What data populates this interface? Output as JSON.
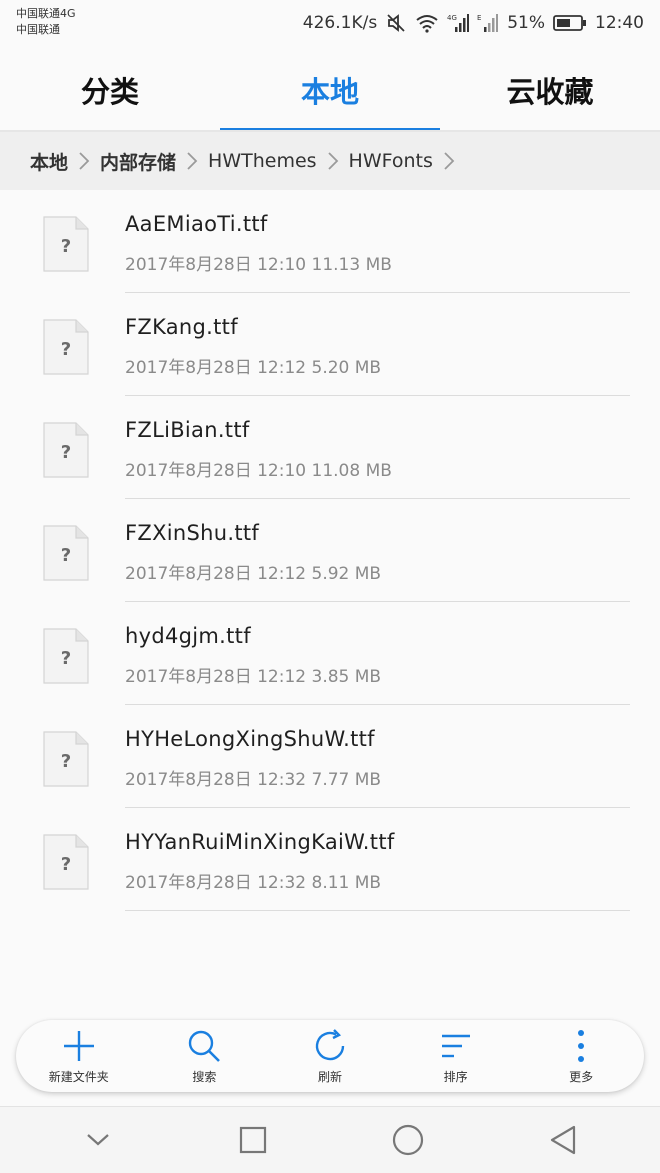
{
  "status": {
    "carrier_line1": "中国联通4G",
    "carrier_line2": "中国联通",
    "speed": "426.1K/s",
    "battery": "51%",
    "time": "12:40"
  },
  "tabs": [
    {
      "label": "分类",
      "active": false
    },
    {
      "label": "本地",
      "active": true
    },
    {
      "label": "云收藏",
      "active": false
    }
  ],
  "breadcrumb": [
    "本地",
    "内部存储",
    "HWThemes",
    "HWFonts"
  ],
  "files": [
    {
      "name": "AaEMiaoTi.ttf",
      "meta": "2017年8月28日 12:10 11.13 MB"
    },
    {
      "name": "FZKang.ttf",
      "meta": "2017年8月28日 12:12 5.20 MB"
    },
    {
      "name": "FZLiBian.ttf",
      "meta": "2017年8月28日 12:10 11.08 MB"
    },
    {
      "name": "FZXinShu.ttf",
      "meta": "2017年8月28日 12:12 5.92 MB"
    },
    {
      "name": "hyd4gjm.ttf",
      "meta": "2017年8月28日 12:12 3.85 MB"
    },
    {
      "name": "HYHeLongXingShuW.ttf",
      "meta": "2017年8月28日 12:32 7.77 MB"
    },
    {
      "name": "HYYanRuiMinXingKaiW.ttf",
      "meta": "2017年8月28日 12:32 8.11 MB"
    }
  ],
  "toolbar": {
    "new_folder": "新建文件夹",
    "search": "搜索",
    "refresh": "刷新",
    "sort": "排序",
    "more": "更多"
  },
  "colors": {
    "accent": "#1a7fe0"
  },
  "icons": {
    "file": "unknown-file-icon",
    "nav_back": "chevron-down-icon",
    "nav_recents": "square-icon",
    "nav_home": "circle-icon",
    "nav_triangle": "triangle-back-icon"
  }
}
